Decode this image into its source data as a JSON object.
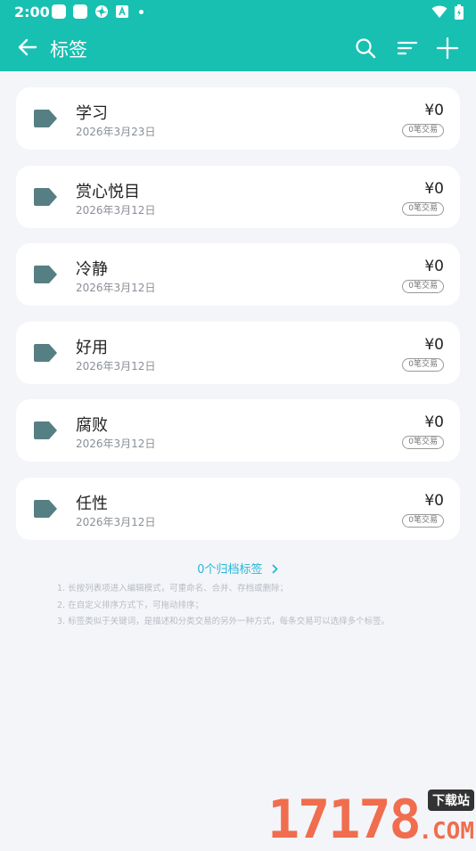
{
  "status_bar": {
    "time": "2:00",
    "icons": [
      "square-icon",
      "square-icon",
      "settings-flower-icon",
      "a-icon",
      "dot-icon",
      "wifi-icon",
      "battery-icon"
    ]
  },
  "header": {
    "title": "标签",
    "icons": [
      "back-arrow-icon",
      "search-icon",
      "sort-icon",
      "plus-icon"
    ],
    "color": "#18c0b2"
  },
  "tags": [
    {
      "name": "学习",
      "date": "2026年3月23日",
      "amount": "¥0",
      "count": "0笔交易"
    },
    {
      "name": "赏心悦目",
      "date": "2026年3月12日",
      "amount": "¥0",
      "count": "0笔交易"
    },
    {
      "name": "冷静",
      "date": "2026年3月12日",
      "amount": "¥0",
      "count": "0笔交易"
    },
    {
      "name": "好用",
      "date": "2026年3月12日",
      "amount": "¥0",
      "count": "0笔交易"
    },
    {
      "name": "腐败",
      "date": "2026年3月12日",
      "amount": "¥0",
      "count": "0笔交易"
    },
    {
      "name": "任性",
      "date": "2026年3月12日",
      "amount": "¥0",
      "count": "0笔交易"
    }
  ],
  "archived_link": "0个归档标签",
  "tips": [
    "1. 长按列表项进入编辑模式，可重命名、合并、存档或删除；",
    "2. 在自定义排序方式下，可拖动排序；",
    "3. 标签类似于关键词，是描述和分类交易的另外一种方式，每条交易可以选择多个标签。"
  ],
  "watermark": {
    "digits": "17178",
    "top": "下载站",
    "bottom": ".COM"
  }
}
